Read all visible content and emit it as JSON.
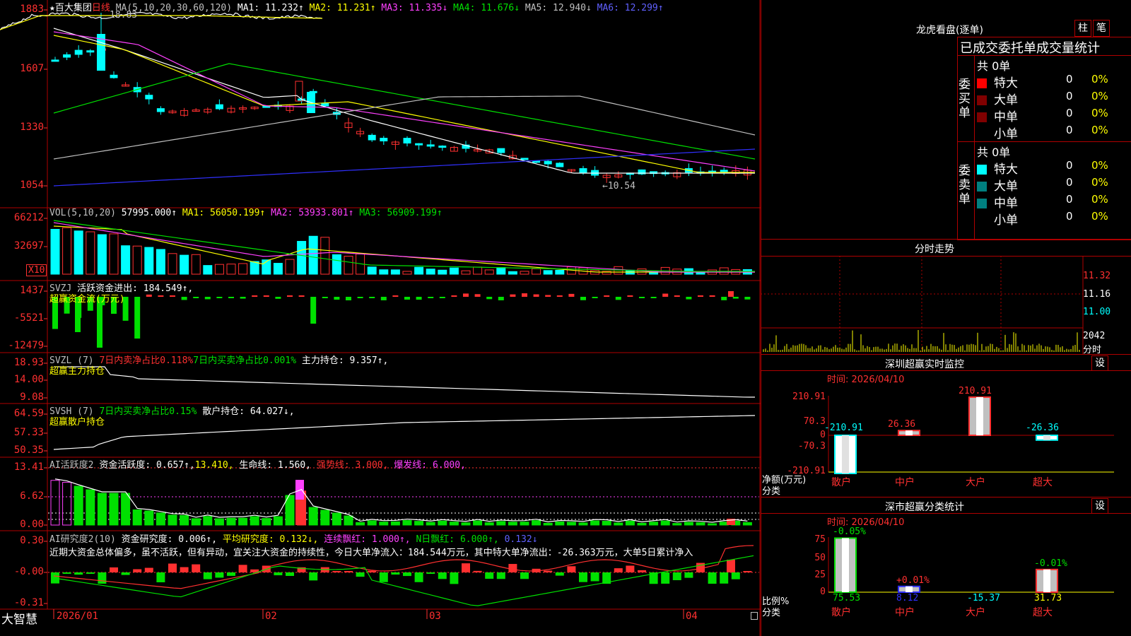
{
  "colors": {
    "up": "#ff3030",
    "down": "#00ffff",
    "grid": "#b00000",
    "ma1": "#ffffff",
    "ma2": "#ffff00",
    "ma3": "#ff40ff",
    "ma4": "#00e000",
    "ma5": "#c0c0c0",
    "ma6": "#3030ff"
  },
  "main": {
    "star": "★",
    "stock_name": "百大集团",
    "period": "日线",
    "ma_label": "MA(5,10,20,30,60,120)",
    "ma1": "MA1: 11.232↑",
    "ma2": "MA2: 11.231↑",
    "ma3": "MA3: 11.335↓",
    "ma4": "MA4: 11.676↓",
    "ma5": "MA5: 12.940↓",
    "ma6": "MA6: 12.299↑",
    "high_mark": "18.83",
    "low_mark": "←10.54",
    "y_ticks": [
      "1883",
      "1607",
      "1330",
      "1054"
    ]
  },
  "vol": {
    "label": "VOL(5,10,20)",
    "value": "57995.000↑",
    "ma1": "MA1: 56050.199↑",
    "ma2": "MA2: 53933.801↑",
    "ma3": "MA3: 56909.199↑",
    "y_ticks": [
      "66212",
      "32697"
    ],
    "unit": "X10"
  },
  "svzj": {
    "label": "SVZJ",
    "desc": "活跃资金进出: 184.549↑,",
    "sub": "超赢资金流(万元)",
    "y_ticks": [
      "1437",
      "-5521",
      "-12479"
    ]
  },
  "svzl": {
    "label": "SVZL (7)",
    "a": "7日内卖净占比0.118%",
    "b": "7日内买卖净占比0.001%",
    "c": "主力持仓: 9.357↑,",
    "sub": "超赢主力持仓",
    "y_ticks": [
      "18.93",
      "14.00",
      "9.08"
    ]
  },
  "svsh": {
    "label": "SVSH (7)",
    "a": "7日内买卖净占比0.15%",
    "b": "散户持仓: 64.027↓,",
    "sub": "超赢散户持仓",
    "y_ticks": [
      "64.59",
      "57.33",
      "50.35"
    ]
  },
  "ai1": {
    "label": "AI活跃度2",
    "a": "资金活跃度: 0.657↑,",
    "b": "13.410,",
    "c": "生命线: 1.560,",
    "d": "强势线: 3.000,",
    "e": "爆发线: 6.000,",
    "y_ticks": [
      "13.41",
      "6.62",
      "0.00"
    ]
  },
  "ai2": {
    "label": "AI研究度2(10)",
    "a": "资金研究度: 0.006↑,",
    "b": "平均研究度: 0.132↓,",
    "c": "连续飘红: 1.000↑,",
    "d": "N日飘红: 6.000↑,",
    "e": "0.132↓",
    "comment": "近期大资金总体偏多，虽不活跃，但有异动，宜关注大资金的持续性，今日大单净流入：184.544万元，其中特大单净流出：-26.363万元，大单5日累计净入",
    "y_ticks": [
      "0.30",
      "-0.00",
      "-0.31"
    ]
  },
  "xaxis": {
    "brand": "大智慧",
    "labels": [
      "2026/01",
      "02",
      "03",
      "04"
    ]
  },
  "right": {
    "lhb_title": "龙虎看盘(逐单)",
    "btn_zhu": "柱",
    "btn_bi": "笔",
    "tabs": "已成交委托单成交量统计",
    "buy_label": "委买单",
    "sell_label": "委卖单",
    "buy_total": "共 0单",
    "sell_total": "共 0单",
    "rows": [
      {
        "name": "特大",
        "count": "0",
        "pct": "0%"
      },
      {
        "name": "大单",
        "count": "0",
        "pct": "0%"
      },
      {
        "name": "中单",
        "count": "0",
        "pct": "0%"
      },
      {
        "name": "小单",
        "count": "0",
        "pct": "0%"
      }
    ],
    "buy_colors": [
      "#ff0000",
      "#800000",
      "#800000",
      ""
    ],
    "sell_colors": [
      "#00ffff",
      "#008080",
      "#008080",
      ""
    ],
    "fenshi_title": "分时走势",
    "fenshi_ticks": [
      "11.32",
      "11.16",
      "11.00"
    ],
    "fenshi_vol": "2042",
    "fenshi_unit": "分时"
  },
  "sz_monitor": {
    "title": "深圳超赢实时监控",
    "btn": "设",
    "time": "时间: 2026/04/10",
    "y_ticks": [
      "210.91",
      "70.3",
      "0",
      "-70.3",
      "-210.91"
    ],
    "ylabel": "净额(万元)",
    "xlabel": "分类",
    "categories": [
      "散户",
      "中户",
      "大户",
      "超大"
    ],
    "values": [
      -210.91,
      26.36,
      210.91,
      -26.36
    ],
    "value_labels": [
      "-210.91",
      "26.36",
      "210.91",
      "-26.36"
    ]
  },
  "sz_class": {
    "title": "深市超赢分类统计",
    "btn": "设",
    "time": "时间: 2026/04/10",
    "y_ticks": [
      "75",
      "50",
      "25",
      "0"
    ],
    "ylabel": "比例%",
    "xlabel": "分类",
    "categories": [
      "散户",
      "中户",
      "大户",
      "超大"
    ],
    "values": [
      75.53,
      8.12,
      -15.37,
      31.73
    ],
    "value_labels": [
      "75.53",
      "8.12",
      "-15.37",
      "31.73"
    ],
    "change_labels": [
      "-0.05%",
      "+0.01%",
      "",
      "-0.01%"
    ]
  }
}
